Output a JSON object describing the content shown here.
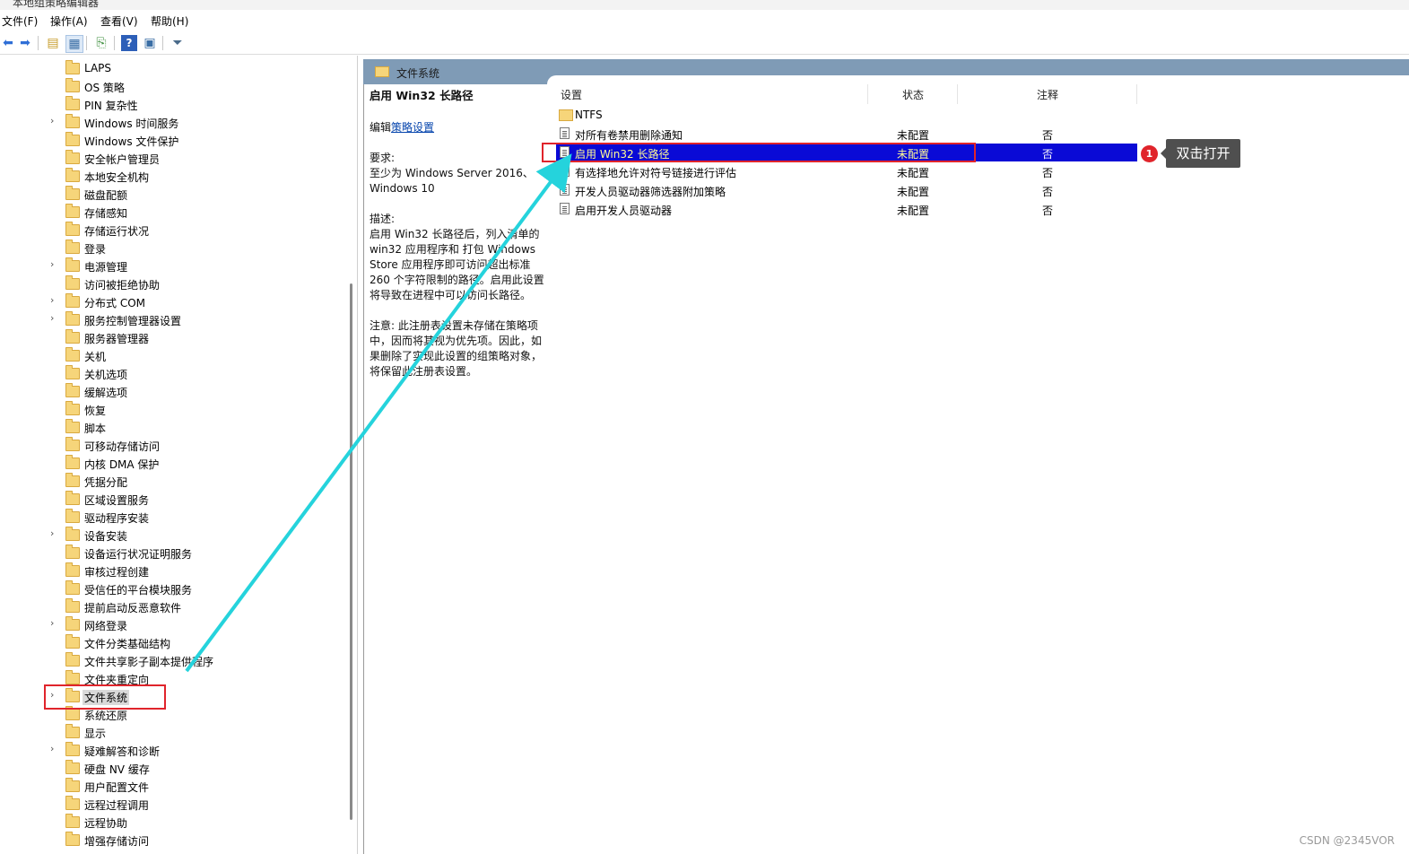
{
  "window": {
    "title": "本地组策略编辑器"
  },
  "menu": {
    "file": "文件(F)",
    "action": "操作(A)",
    "view": "查看(V)",
    "help": "帮助(H)"
  },
  "tree": {
    "items": [
      {
        "label": "LAPS",
        "expandable": false
      },
      {
        "label": "OS 策略",
        "expandable": false
      },
      {
        "label": "PIN 复杂性",
        "expandable": false
      },
      {
        "label": "Windows 时间服务",
        "expandable": true
      },
      {
        "label": "Windows 文件保护",
        "expandable": false
      },
      {
        "label": "安全帐户管理员",
        "expandable": false
      },
      {
        "label": "本地安全机构",
        "expandable": false
      },
      {
        "label": "磁盘配额",
        "expandable": false
      },
      {
        "label": "存储感知",
        "expandable": false
      },
      {
        "label": "存储运行状况",
        "expandable": false
      },
      {
        "label": "登录",
        "expandable": false
      },
      {
        "label": "电源管理",
        "expandable": true
      },
      {
        "label": "访问被拒绝协助",
        "expandable": false
      },
      {
        "label": "分布式 COM",
        "expandable": true
      },
      {
        "label": "服务控制管理器设置",
        "expandable": true
      },
      {
        "label": "服务器管理器",
        "expandable": false
      },
      {
        "label": "关机",
        "expandable": false
      },
      {
        "label": "关机选项",
        "expandable": false
      },
      {
        "label": "缓解选项",
        "expandable": false
      },
      {
        "label": "恢复",
        "expandable": false
      },
      {
        "label": "脚本",
        "expandable": false
      },
      {
        "label": "可移动存储访问",
        "expandable": false
      },
      {
        "label": "内核 DMA 保护",
        "expandable": false
      },
      {
        "label": "凭据分配",
        "expandable": false
      },
      {
        "label": "区域设置服务",
        "expandable": false
      },
      {
        "label": "驱动程序安装",
        "expandable": false
      },
      {
        "label": "设备安装",
        "expandable": true
      },
      {
        "label": "设备运行状况证明服务",
        "expandable": false
      },
      {
        "label": "审核过程创建",
        "expandable": false
      },
      {
        "label": "受信任的平台模块服务",
        "expandable": false
      },
      {
        "label": "提前启动反恶意软件",
        "expandable": false
      },
      {
        "label": "网络登录",
        "expandable": true
      },
      {
        "label": "文件分类基础结构",
        "expandable": false
      },
      {
        "label": "文件共享影子副本提供程序",
        "expandable": false
      },
      {
        "label": "文件夹重定向",
        "expandable": false
      },
      {
        "label": "文件系统",
        "expandable": true,
        "selected": true
      },
      {
        "label": "系统还原",
        "expandable": false
      },
      {
        "label": "显示",
        "expandable": false
      },
      {
        "label": "疑难解答和诊断",
        "expandable": true
      },
      {
        "label": "硬盘 NV 缓存",
        "expandable": false
      },
      {
        "label": "用户配置文件",
        "expandable": false
      },
      {
        "label": "远程过程调用",
        "expandable": false
      },
      {
        "label": "远程协助",
        "expandable": false
      },
      {
        "label": "增强存储访问",
        "expandable": false
      }
    ]
  },
  "right": {
    "header_title": "文件系统",
    "desc": {
      "title": "启用 Win32 长路径",
      "edit_prefix": "编辑",
      "edit_link": "策略设置",
      "req_label": "要求:",
      "req_text": "至少为 Windows Server 2016、Windows 10",
      "desc_label": "描述:",
      "desc_text": "启用 Win32 长路径后，列入清单的 win32 应用程序和 打包 Windows Store 应用程序即可访问超出标准 260 个字符限制的路径。启用此设置将导致在进程中可以访问长路径。",
      "note_text": "注意: 此注册表设置未存储在策略项中，因而将其视为优先项。因此，如果删除了实现此设置的组策略对象，将保留此注册表设置。"
    },
    "columns": {
      "setting": "设置",
      "state": "状态",
      "comment": "注释"
    },
    "rows": [
      {
        "type": "folder",
        "name": "NTFS",
        "state": "",
        "note": ""
      },
      {
        "type": "policy",
        "name": "对所有卷禁用删除通知",
        "state": "未配置",
        "note": "否"
      },
      {
        "type": "policy",
        "name": "启用 Win32 长路径",
        "state": "未配置",
        "note": "否",
        "selected": true
      },
      {
        "type": "policy",
        "name": "有选择地允许对符号链接进行评估",
        "state": "未配置",
        "note": "否"
      },
      {
        "type": "policy",
        "name": "开发人员驱动器筛选器附加策略",
        "state": "未配置",
        "note": "否"
      },
      {
        "type": "policy",
        "name": "启用开发人员驱动器",
        "state": "未配置",
        "note": "否"
      }
    ]
  },
  "annotation": {
    "badge": "1",
    "tooltip": "双击打开"
  },
  "watermark": "CSDN @2345VOR",
  "colors": {
    "selection": "#0a0ad6",
    "annotation_red": "#e0242b",
    "arrow": "#25d3dc",
    "header_bar": "#7f9bb6"
  }
}
